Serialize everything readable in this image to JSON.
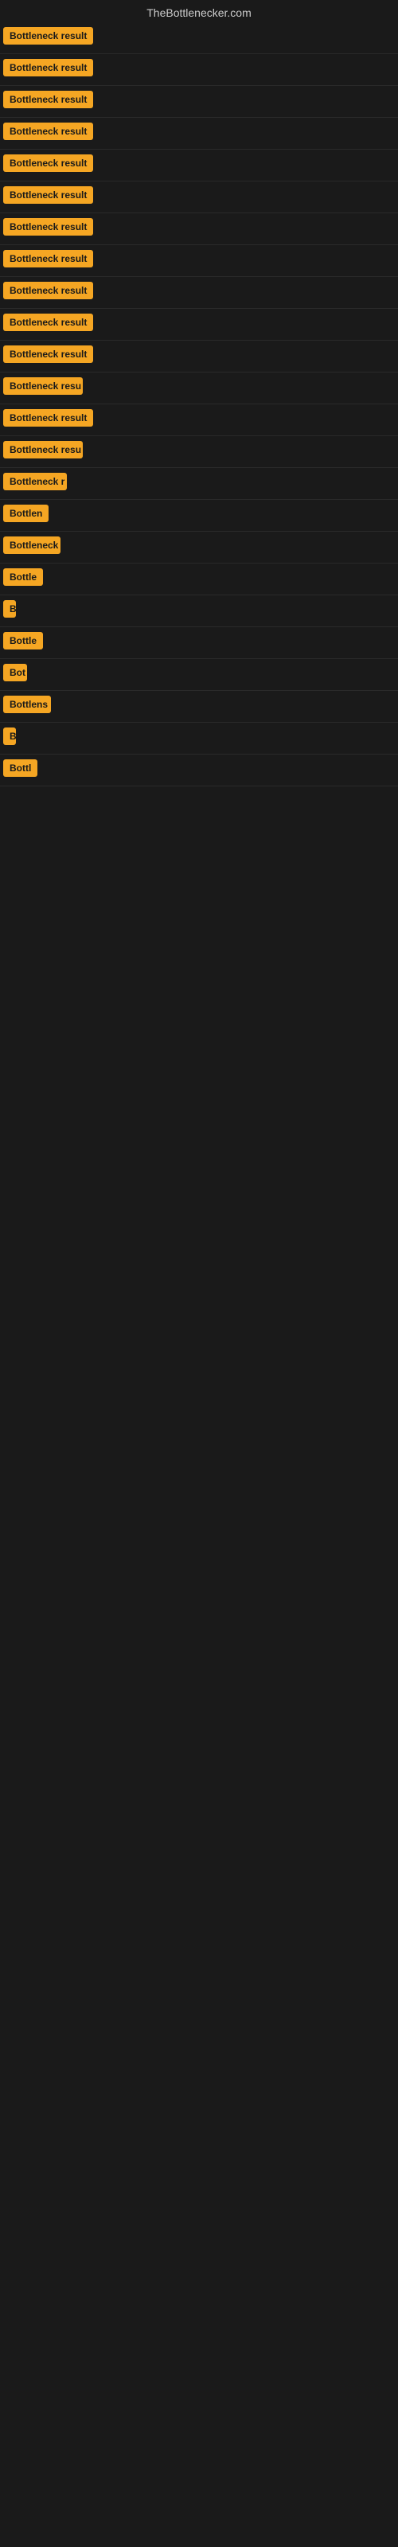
{
  "site": {
    "title": "TheBottlenecker.com"
  },
  "rows": [
    {
      "id": 1,
      "label": "Bottleneck result",
      "badge_width": 115
    },
    {
      "id": 2,
      "label": "Bottleneck result",
      "badge_width": 115
    },
    {
      "id": 3,
      "label": "Bottleneck result",
      "badge_width": 115
    },
    {
      "id": 4,
      "label": "Bottleneck result",
      "badge_width": 115
    },
    {
      "id": 5,
      "label": "Bottleneck result",
      "badge_width": 115
    },
    {
      "id": 6,
      "label": "Bottleneck result",
      "badge_width": 115
    },
    {
      "id": 7,
      "label": "Bottleneck result",
      "badge_width": 115
    },
    {
      "id": 8,
      "label": "Bottleneck result",
      "badge_width": 115
    },
    {
      "id": 9,
      "label": "Bottleneck result",
      "badge_width": 115
    },
    {
      "id": 10,
      "label": "Bottleneck result",
      "badge_width": 115
    },
    {
      "id": 11,
      "label": "Bottleneck result",
      "badge_width": 115
    },
    {
      "id": 12,
      "label": "Bottleneck resu",
      "badge_width": 100
    },
    {
      "id": 13,
      "label": "Bottleneck result",
      "badge_width": 115
    },
    {
      "id": 14,
      "label": "Bottleneck resu",
      "badge_width": 100
    },
    {
      "id": 15,
      "label": "Bottleneck r",
      "badge_width": 80
    },
    {
      "id": 16,
      "label": "Bottlen",
      "badge_width": 58
    },
    {
      "id": 17,
      "label": "Bottleneck",
      "badge_width": 72
    },
    {
      "id": 18,
      "label": "Bottle",
      "badge_width": 50
    },
    {
      "id": 19,
      "label": "B",
      "badge_width": 16
    },
    {
      "id": 20,
      "label": "Bottle",
      "badge_width": 50
    },
    {
      "id": 21,
      "label": "Bot",
      "badge_width": 30
    },
    {
      "id": 22,
      "label": "Bottlens",
      "badge_width": 60
    },
    {
      "id": 23,
      "label": "B",
      "badge_width": 16
    },
    {
      "id": 24,
      "label": "Bottl",
      "badge_width": 44
    }
  ]
}
